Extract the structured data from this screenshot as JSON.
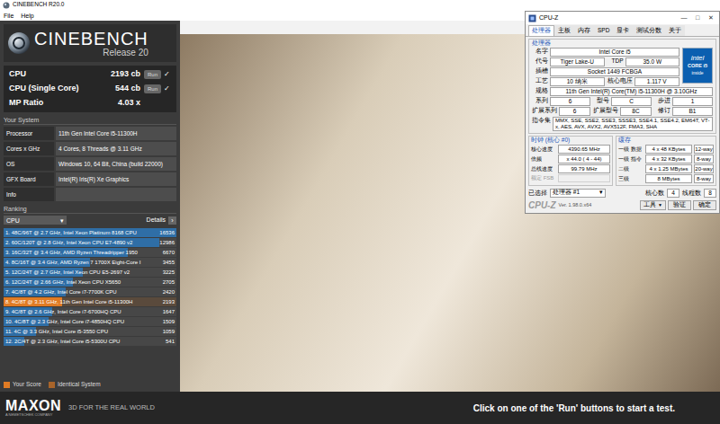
{
  "window": {
    "title": "CINEBENCH R20.0"
  },
  "menu": [
    "File",
    "Help"
  ],
  "logo": {
    "name": "CINEBENCH",
    "release": "Release 20"
  },
  "results": [
    {
      "kind": "test",
      "label": "CPU",
      "score": "2193 cb",
      "button": "Run",
      "done": true,
      "check": "✓"
    },
    {
      "kind": "test",
      "label": "CPU (Single Core)",
      "score": "544 cb",
      "button": "Run",
      "done": true,
      "check": "✓"
    },
    {
      "kind": "ratio",
      "label": "MP Ratio",
      "score": "4.03 x"
    }
  ],
  "system": {
    "title": "Your System",
    "rows": [
      {
        "label": "Processor",
        "value": "11th Gen Intel Core i5-11300H"
      },
      {
        "label": "Cores x GHz",
        "value": "4 Cores, 8 Threads @ 3.11 GHz"
      },
      {
        "label": "OS",
        "value": "Windows 10, 64 Bit, China (build 22000)"
      },
      {
        "label": "GFX Board",
        "value": "Intel(R) Iris(R) Xe Graphics"
      },
      {
        "label": "Info",
        "value": ""
      }
    ]
  },
  "ranking": {
    "title": "Ranking",
    "dropdown": "CPU",
    "dropdown_arrow": "▾",
    "details": "Details",
    "details_button": "›",
    "rows": [
      {
        "text": "1. 48C/96T @ 2.7 GHz, Intel Xeon Platinum 8168 CPU",
        "score": "16536",
        "level": 1,
        "selected": false,
        "color": "#2f6ea6"
      },
      {
        "text": "2. 60C/120T @ 2.8 GHz, Intel Xeon CPU E7-4890 v2",
        "score": "12986",
        "level": 0.9,
        "selected": false,
        "color": "#2f6ea6"
      },
      {
        "text": "3. 16C/32T @ 3.4 GHz, AMD Ryzen Threadripper 1950",
        "score": "6670",
        "level": 0.72,
        "selected": false,
        "color": "#2f6ea6"
      },
      {
        "text": "4. 8C/16T @ 3.4 GHz, AMD Ryzen 7 1700X Eight-Core I",
        "score": "3455",
        "level": 0.5,
        "selected": false,
        "color": "#2f6ea6"
      },
      {
        "text": "5. 12C/24T @ 2.7 GHz, Intel Xeon CPU E5-2697 v2",
        "score": "3225",
        "level": 0.46,
        "selected": false,
        "color": "#2f6ea6"
      },
      {
        "text": "6. 12C/24T @ 2.66 GHz, Intel Xeon CPU X5650",
        "score": "2705",
        "level": 0.4,
        "selected": false,
        "color": "#2f6ea6"
      },
      {
        "text": "7. 4C/8T @ 4.2 GHz, Intel Core i7-7700K CPU",
        "score": "2420",
        "level": 0.36,
        "selected": false,
        "color": "#2f6ea6"
      },
      {
        "text": "8. 4C/8T @ 3.11 GHz, 11th Gen Intel Core i5-11300H",
        "score": "2193",
        "level": 0.34,
        "selected": true,
        "color": "#e07b24"
      },
      {
        "text": "9. 4C/8T @ 2.6 GHz, Intel Core i7-6700HQ CPU",
        "score": "1647",
        "level": 0.28,
        "selected": false,
        "color": "#2f6ea6"
      },
      {
        "text": "10. 4C/8T @ 2.3 GHz, Intel Core i7-4850HQ CPU",
        "score": "1509",
        "level": 0.26,
        "selected": false,
        "color": "#2f6ea6"
      },
      {
        "text": "11. 4C @ 3.3 GHz, Intel Core i5-3550 CPU",
        "score": "1059",
        "level": 0.19,
        "selected": false,
        "color": "#2f6ea6"
      },
      {
        "text": "12. 2C/4T @ 2.3 GHz, Intel Core i5-5300U CPU",
        "score": "541",
        "level": 0.12,
        "selected": false,
        "color": "#2f6ea6"
      }
    ]
  },
  "legend": [
    {
      "label": "Your Score",
      "color": "#e07b24"
    },
    {
      "label": "Identical System",
      "color": "#a8642a"
    }
  ],
  "footer": {
    "brand": "MAXON",
    "sub": "A NEMETSCHEK COMPANY",
    "tagline": "3D FOR THE REAL WORLD",
    "hint": "Click on one of the 'Run' buttons to start a test."
  },
  "cpuz": {
    "title": "CPU-Z",
    "controls": [
      "—",
      "□",
      "✕"
    ],
    "tabs": [
      {
        "label": "处理器",
        "selected": true
      },
      {
        "label": "主板",
        "selected": false
      },
      {
        "label": "内存",
        "selected": false
      },
      {
        "label": "SPD",
        "selected": false
      },
      {
        "label": "显卡",
        "selected": false
      },
      {
        "label": "测试分数",
        "selected": false
      },
      {
        "label": "关于",
        "selected": false
      }
    ],
    "processor": {
      "title": "处理器",
      "logo": {
        "brand": "intel",
        "line": "CORE i5",
        "foot": "inside"
      },
      "top_rows": [
        [
          {
            "label": "名字",
            "value": "Intel Core i5"
          }
        ],
        [
          {
            "label": "代号",
            "value": "Tiger Lake-U"
          },
          {
            "label": "TDP",
            "value": "35.0 W"
          }
        ],
        [
          {
            "label": "插槽",
            "value": "Socket 1449 FCBGA"
          }
        ],
        [
          {
            "label": "工艺",
            "value": "10 纳米"
          },
          {
            "label": "核心电压",
            "value": "1.117 V"
          }
        ]
      ],
      "rows": [
        [
          {
            "label": "规格",
            "value": "11th Gen Intel(R) Core(TM) i5-11300H @ 3.10GHz"
          }
        ],
        [
          {
            "label": "系列",
            "value": "6"
          },
          {
            "label": "型号",
            "value": "C"
          },
          {
            "label": "步进",
            "value": "1"
          }
        ],
        [
          {
            "label": "扩展系列",
            "value": "6"
          },
          {
            "label": "扩展型号",
            "value": "8C"
          },
          {
            "label": "修订",
            "value": "B1"
          }
        ]
      ],
      "instructions": {
        "label": "指令集",
        "value": "MMX, SSE, SSE2, SSE3, SSSE3, SSE4.1, SSE4.2, EM64T, VT-x, AES, AVX, AVX2, AVX512F, FMA3, SHA"
      }
    },
    "clocks": {
      "title": "时钟 (核心 #0)",
      "rows": [
        {
          "label": "核心速度",
          "value": "4390.65 MHz",
          "disabled": false
        },
        {
          "label": "倍频",
          "value": "x 44.0 ( 4 - 44)",
          "disabled": false
        },
        {
          "label": "总线速度",
          "value": "99.79 MHz",
          "disabled": false
        },
        {
          "label": "额定 FSB",
          "value": "",
          "disabled": true
        }
      ]
    },
    "cache": {
      "title": "缓存",
      "rows": [
        {
          "label": "一级 数据",
          "value": "4 x 48 KBytes",
          "way": "12-way"
        },
        {
          "label": "一级 指令",
          "value": "4 x 32 KBytes",
          "way": "8-way"
        },
        {
          "label": "二级",
          "value": "4 x 1.25 MBytes",
          "way": "20-way"
        },
        {
          "label": "三级",
          "value": "8 MBytes",
          "way": "8-way"
        }
      ]
    },
    "selection": {
      "label": "已选择",
      "value": "处理器 #1",
      "arrow": "▾",
      "cores_label": "核心数",
      "cores": "4",
      "threads_label": "线程数",
      "threads": "8"
    },
    "footer": {
      "brand": "CPU-Z",
      "version": "Ver. 1.98.0.x64",
      "buttons": [
        {
          "label": "工具",
          "arrow": "▼"
        },
        {
          "label": "验证",
          "arrow": ""
        },
        {
          "label": "确定",
          "arrow": ""
        }
      ]
    }
  }
}
